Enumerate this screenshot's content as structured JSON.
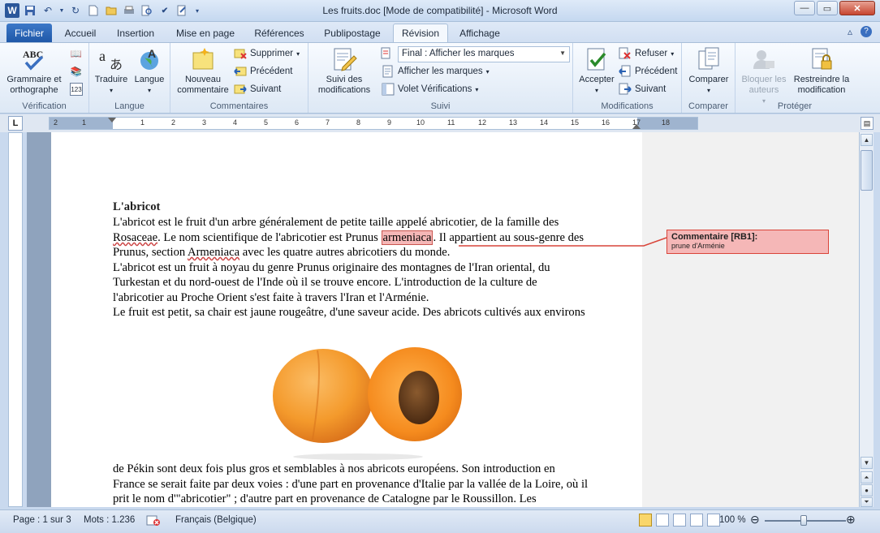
{
  "window": {
    "title": "Les fruits.doc [Mode de compatibilité] - Microsoft Word"
  },
  "tabs": [
    {
      "label": "Fichier"
    },
    {
      "label": "Accueil"
    },
    {
      "label": "Insertion"
    },
    {
      "label": "Mise en page"
    },
    {
      "label": "Références"
    },
    {
      "label": "Publipostage"
    },
    {
      "label": "Révision"
    },
    {
      "label": "Affichage"
    }
  ],
  "ribbon": {
    "verification": {
      "label": "Vérification",
      "spell": "Grammaire et orthographe"
    },
    "langue": {
      "label": "Langue",
      "translate": "Traduire",
      "language": "Langue"
    },
    "commentaires": {
      "label": "Commentaires",
      "new": "Nouveau commentaire",
      "delete": "Supprimer",
      "prev": "Précédent",
      "next": "Suivant"
    },
    "suivi": {
      "label": "Suivi",
      "track": "Suivi des modifications",
      "combo": "Final : Afficher les marques",
      "show_markup": "Afficher les marques",
      "pane": "Volet Vérifications"
    },
    "modifications": {
      "label": "Modifications",
      "accept": "Accepter",
      "reject": "Refuser",
      "prev": "Précédent",
      "next": "Suivant"
    },
    "comparer": {
      "label": "Comparer",
      "compare": "Comparer"
    },
    "proteger": {
      "label": "Protéger",
      "block": "Bloquer les auteurs",
      "restrict": "Restreindre la modification"
    }
  },
  "document": {
    "heading": "L'abricot",
    "lines": {
      "l1": "L'abricot est le fruit d'un arbre généralement de petite taille appelé abricotier, de la famille des",
      "l2a": "Rosaceae",
      "l2b": ". Le nom scientifique de l'abricotier est Prunus ",
      "l2c": "armeniaca",
      "l2d": ". Il appartient au sous-genre des",
      "l3a": "Prunus, section ",
      "l3b": "Armeniaca",
      "l3c": " avec les quatre autres abricotiers  du monde.",
      "l4": "L'abricot est un fruit à noyau du genre Prunus originaire  des montagnes  de l'Iran oriental,  du",
      "l5": "Turkestan  et du nord-ouest de l'Inde où il se trouve encore. L'introduction de la culture de",
      "l6": "l'abricotier  au Proche Orient s'est faite à travers l'Iran et l'Arménie.",
      "l7": "Le fruit est petit, sa chair est jaune rougeâtre, d'une saveur acide. Des abricots cultivés aux environs",
      "l8": "de Pékin sont deux fois plus gros et semblables  à nos abricots européens.  Son introduction en",
      "l9": "France se serait  faite par deux voies : d'une part en provenance d'Italie par la vallée  de la Loire, où il",
      "l10": "prit le nom d'\"abricotier\" ; d'autre part en provenance de Catalogne par le Roussillon.  Les"
    },
    "comment": {
      "title": "Commentaire [RB1]:",
      "body": "prune d'Arménie"
    }
  },
  "status": {
    "page": "Page : 1 sur 3",
    "words": "Mots : 1.236",
    "language": "Français (Belgique)",
    "zoom": "100 %"
  },
  "colors": {
    "accent": "#2b579a",
    "comment_fill": "#f5b7b7",
    "comment_border": "#d9453a"
  }
}
